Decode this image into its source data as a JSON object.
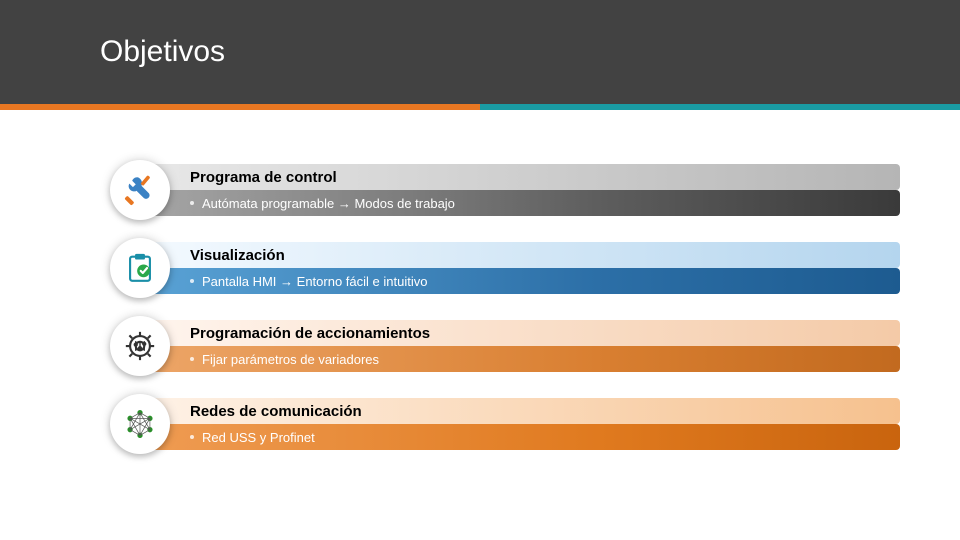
{
  "title": "Objetivos",
  "items": [
    {
      "icon": "tools-icon",
      "theme": "theme-grey",
      "heading": "Programa de control",
      "sub": "Autómata programable → Modos de trabajo"
    },
    {
      "icon": "checklist-icon",
      "theme": "theme-blue",
      "heading": "Visualización",
      "sub": "Pantalla HMI →  Entorno fácil e intuitivo"
    },
    {
      "icon": "gear-sliders-icon",
      "theme": "theme-org1",
      "heading": "Programación de accionamientos",
      "sub": " Fijar parámetros de variadores"
    },
    {
      "icon": "network-icon",
      "theme": "theme-org2",
      "heading": "Redes de comunicación",
      "sub": " Red USS y Profinet"
    }
  ]
}
